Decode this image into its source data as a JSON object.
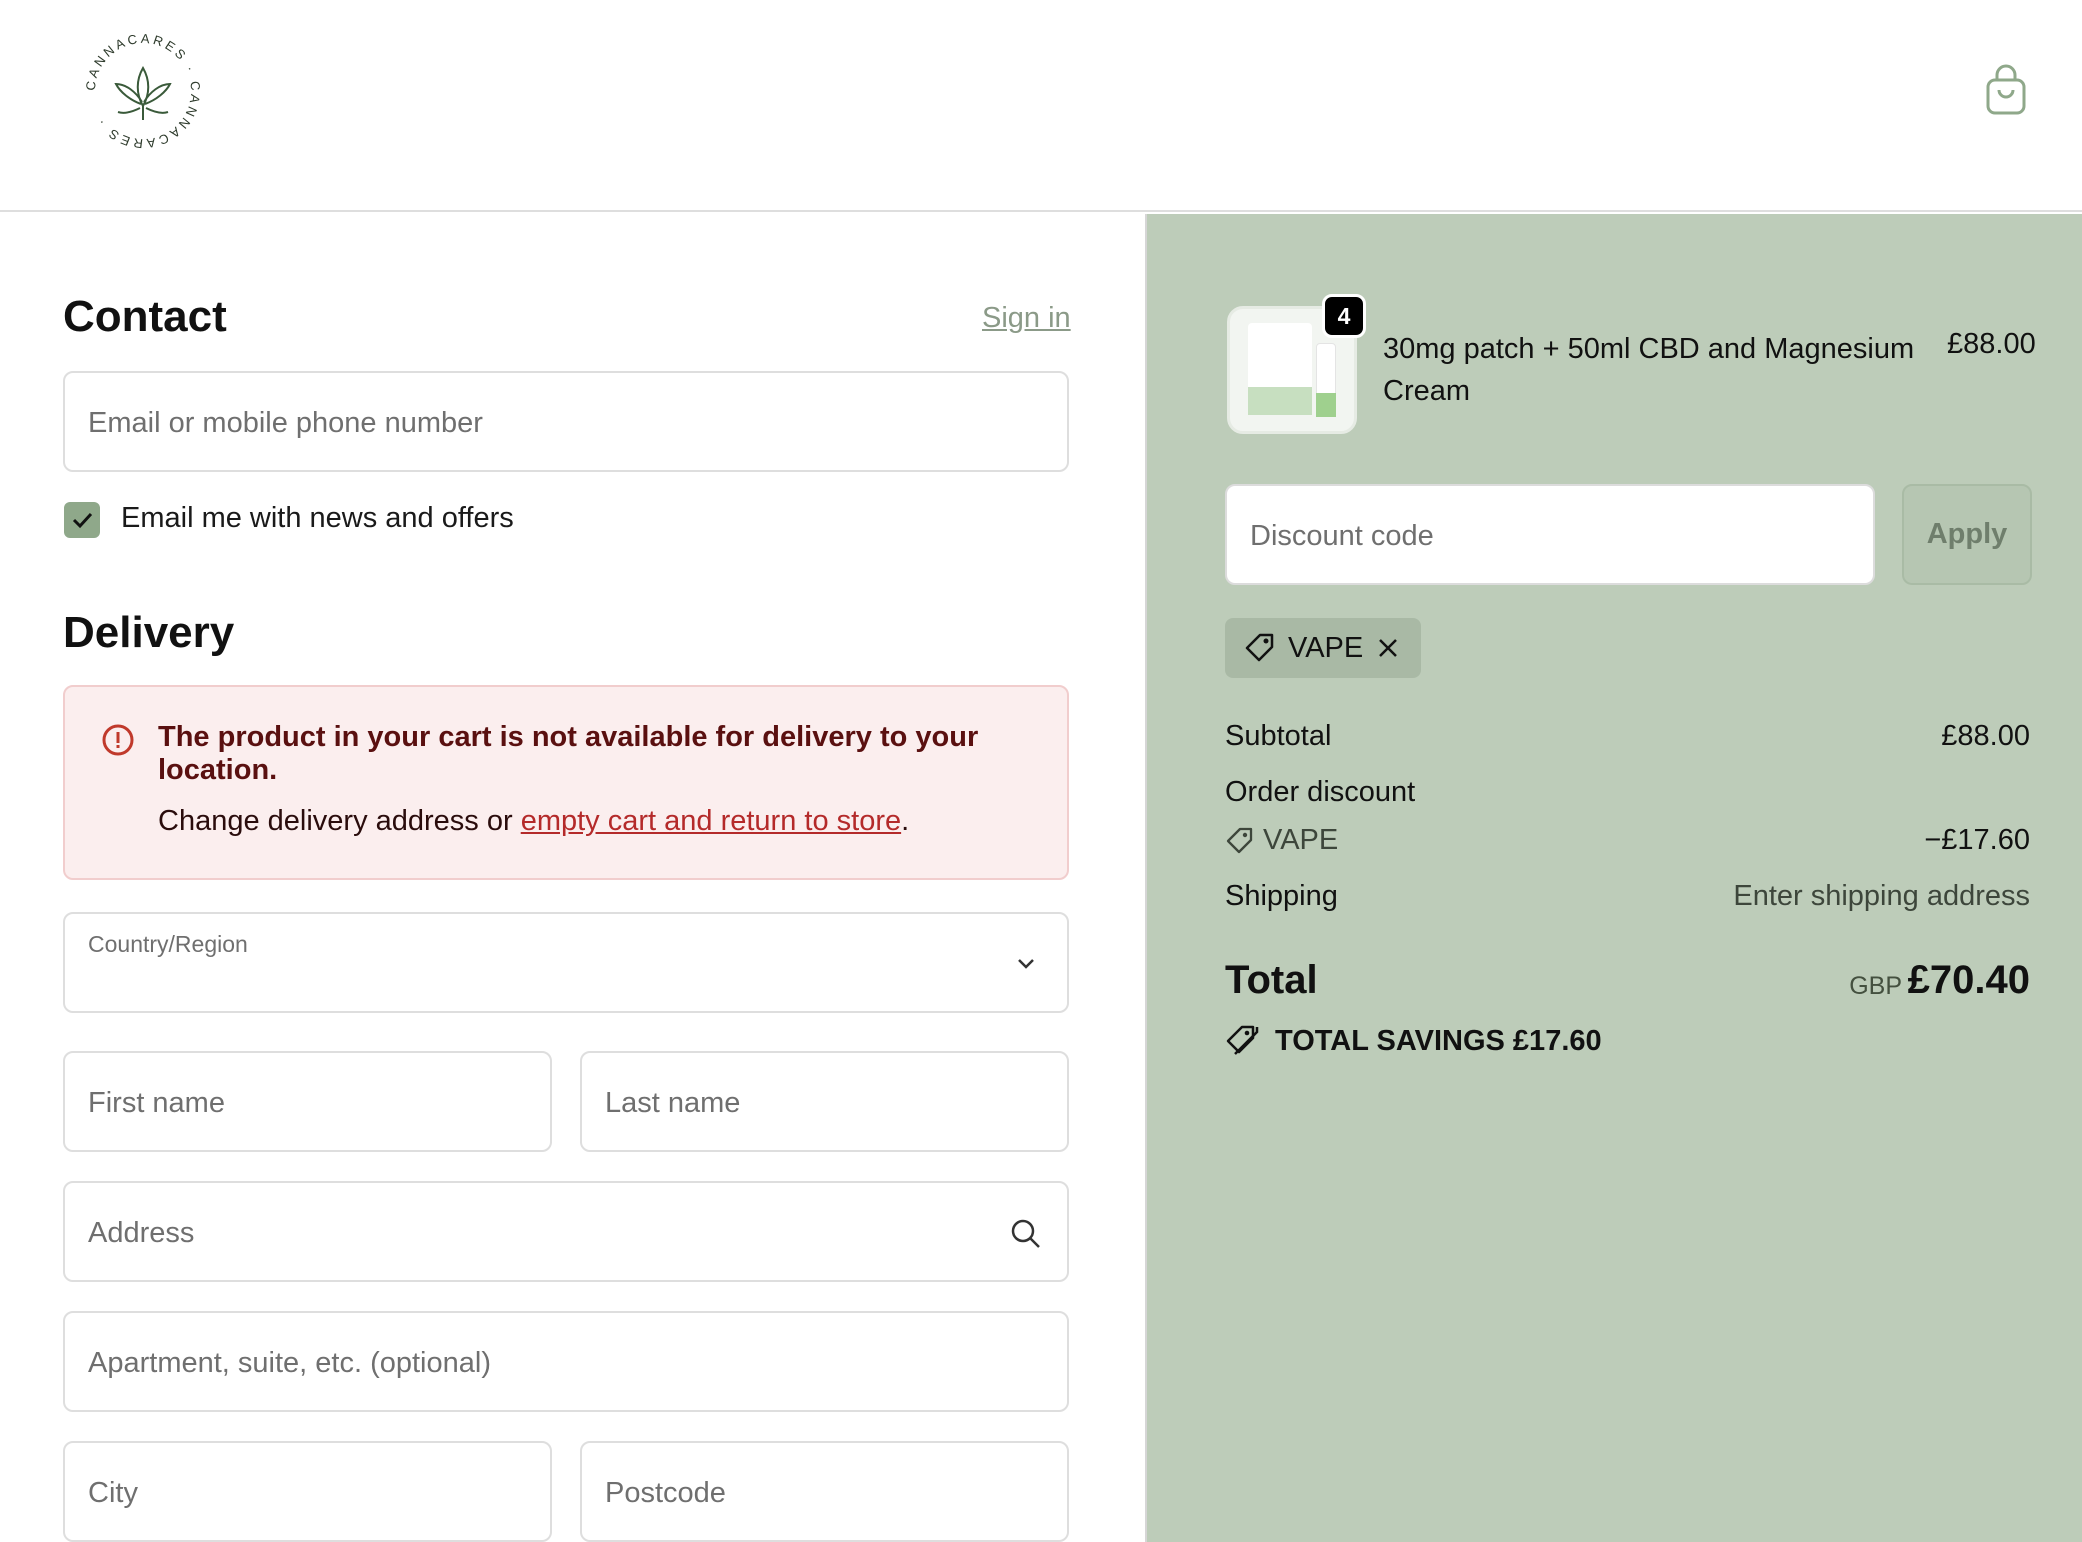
{
  "header": {
    "logo_text": "CANNACARES · CANNACARES ·"
  },
  "contact": {
    "title": "Contact",
    "sign_in": "Sign in",
    "email_placeholder": "Email or mobile phone number",
    "newsletter_checked": true,
    "newsletter_label": "Email me with news and offers"
  },
  "delivery": {
    "title": "Delivery",
    "alert": {
      "title": "The product in your cart is not available for delivery to your location.",
      "body_prefix": "Change delivery address or ",
      "link": "empty cart and return to store",
      "body_suffix": "."
    },
    "country_label": "Country/Region",
    "first_name_placeholder": "First name",
    "last_name_placeholder": "Last name",
    "address_placeholder": "Address",
    "apartment_placeholder": "Apartment, suite, etc. (optional)",
    "city_placeholder": "City",
    "postcode_placeholder": "Postcode"
  },
  "summary": {
    "item": {
      "quantity": "4",
      "name": "30mg patch + 50ml CBD and Magnesium Cream",
      "price": "£88.00"
    },
    "discount_placeholder": "Discount code",
    "apply_label": "Apply",
    "applied_code": "VAPE",
    "subtotal_label": "Subtotal",
    "subtotal_value": "£88.00",
    "order_discount_label": "Order discount",
    "discount_code_name": "VAPE",
    "discount_value": "−£17.60",
    "shipping_label": "Shipping",
    "shipping_value": "Enter shipping address",
    "total_label": "Total",
    "total_currency": "GBP",
    "total_value": "£70.40",
    "savings_label": "TOTAL SAVINGS  £17.60"
  },
  "colors": {
    "summary_bg": "#bdccb9",
    "checkbox": "#8fa88a",
    "alert_bg": "#fbeeee",
    "alert_text": "#5a1010",
    "link_error": "#b42a2a"
  },
  "icons": [
    "cannacares-logo-icon",
    "shopping-bag-icon",
    "checkmark-icon",
    "error-circle-icon",
    "chevron-down-icon",
    "search-icon",
    "tag-icon",
    "close-icon",
    "savings-tag-icon"
  ]
}
